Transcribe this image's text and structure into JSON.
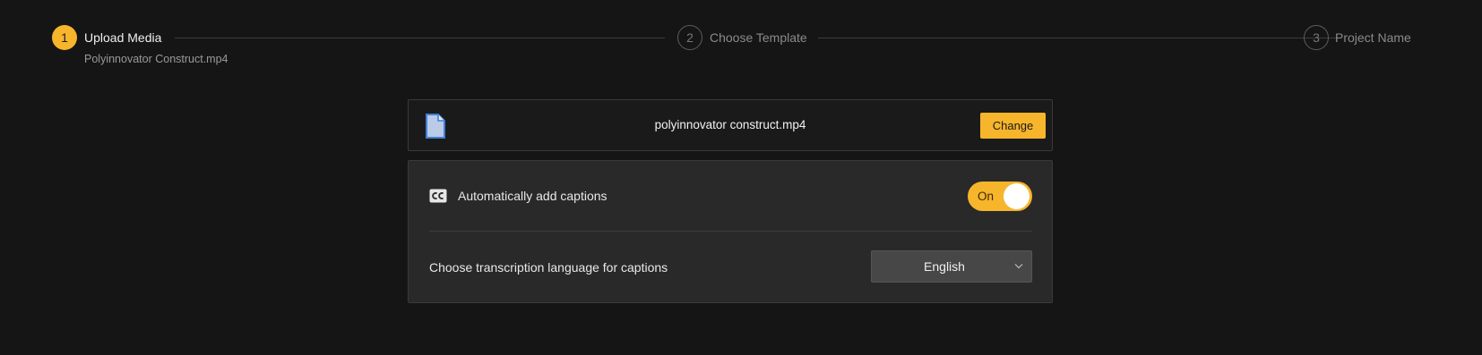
{
  "stepper": {
    "steps": [
      {
        "number": "1",
        "label": "Upload Media",
        "subtitle": "Polyinnovator Construct.mp4",
        "state": "active"
      },
      {
        "number": "2",
        "label": "Choose Template",
        "state": "inactive"
      },
      {
        "number": "3",
        "label": "Project Name",
        "state": "inactive"
      }
    ]
  },
  "file": {
    "name": "polyinnovator construct.mp4",
    "change_label": "Change",
    "icon": "document-icon"
  },
  "captions": {
    "icon": "closed-captions-icon",
    "label": "Automatically add captions",
    "toggle_state": "On"
  },
  "language": {
    "label": "Choose transcription language for captions",
    "selected": "English"
  },
  "colors": {
    "accent": "#f7b52c",
    "background": "#151515",
    "card": "#292929",
    "file_icon": "#3f7fd6"
  }
}
